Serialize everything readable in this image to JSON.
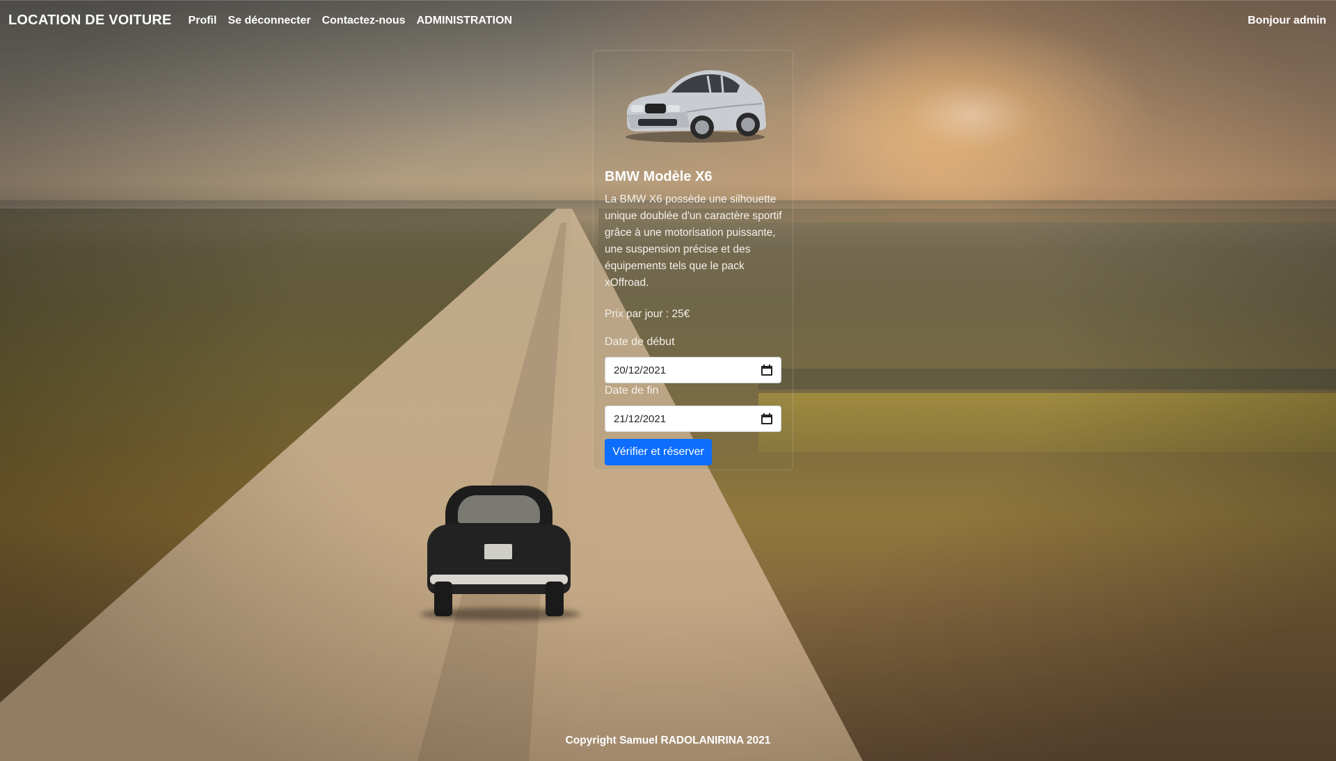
{
  "navbar": {
    "brand": "LOCATION DE VOITURE",
    "links": [
      "Profil",
      "Se déconnecter",
      "Contactez-nous",
      "ADMINISTRATION"
    ],
    "greeting": "Bonjour admin"
  },
  "card": {
    "title": "BMW Modèle X6",
    "description": "La BMW X6 possède une silhouette unique doublée d'un caractère sportif grâce à une motorisation puissante, une suspension précise et des équipements tels que le pack xOffroad.",
    "price": "Prix par jour : 25€",
    "start_label": "Date de début",
    "start_value": "20/12/2021",
    "end_label": "Date de fin",
    "end_value": "21/12/2021",
    "submit_label": "Vérifier et réserver"
  },
  "footer": {
    "copyright": "Copyright Samuel RADOLANIRINA 2021"
  },
  "colors": {
    "primary": "#0d6efd",
    "text": "#ffffff"
  },
  "icons": [
    "calendar-icon"
  ]
}
